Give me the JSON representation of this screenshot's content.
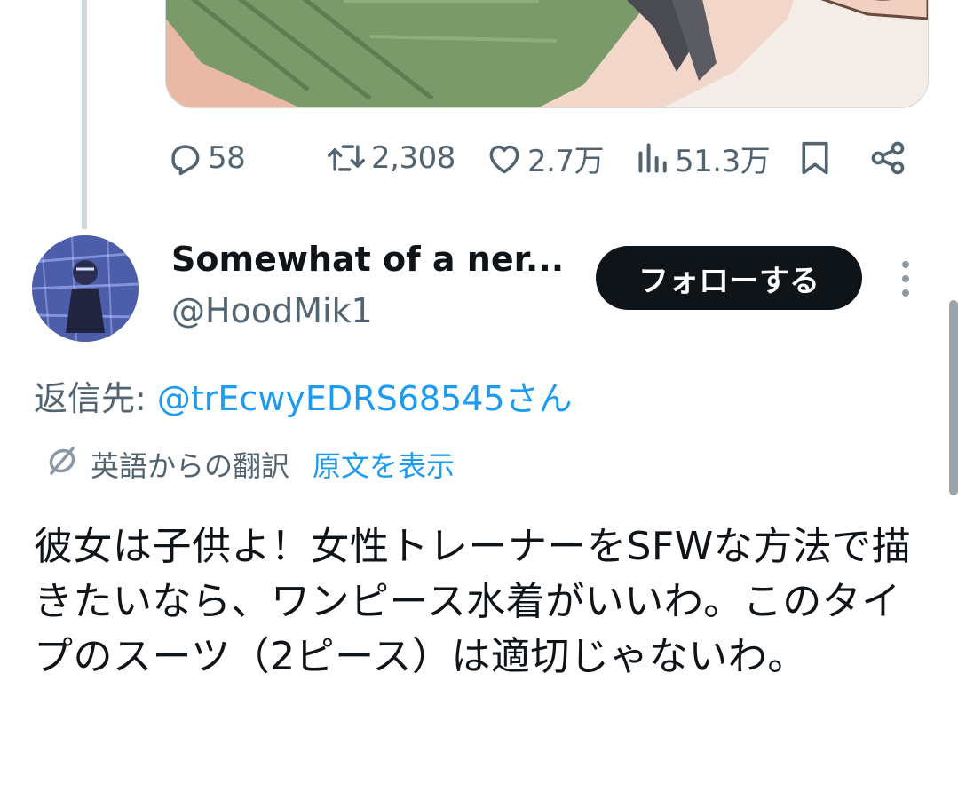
{
  "tweet_actions": {
    "replies": "58",
    "reposts": "2,308",
    "likes": "2.7万",
    "views": "51.3万"
  },
  "reply": {
    "display_name": "Somewhat of a ner...",
    "handle": "@HoodMik1",
    "follow_label": "フォローする",
    "reply_prefix": "返信先:",
    "reply_mention": "@trEcwyEDRS68545さん",
    "translation_label": "英語からの翻訳",
    "show_original": "原文を表示",
    "text": "彼女は子供よ！女性トレーナーをSFWな方法で描きたいなら、ワンピース水着がいいわ。このタイプのスーツ（2ピース）は適切じゃないわ。"
  },
  "colors": {
    "accent": "#1d9bf0",
    "text_primary": "#0f1419",
    "text_secondary": "#536471",
    "button_dark": "#0f1419"
  },
  "icons": [
    "reply-icon",
    "repost-icon",
    "like-icon",
    "views-icon",
    "bookmark-icon",
    "share-icon",
    "more-icon",
    "translate-icon"
  ]
}
